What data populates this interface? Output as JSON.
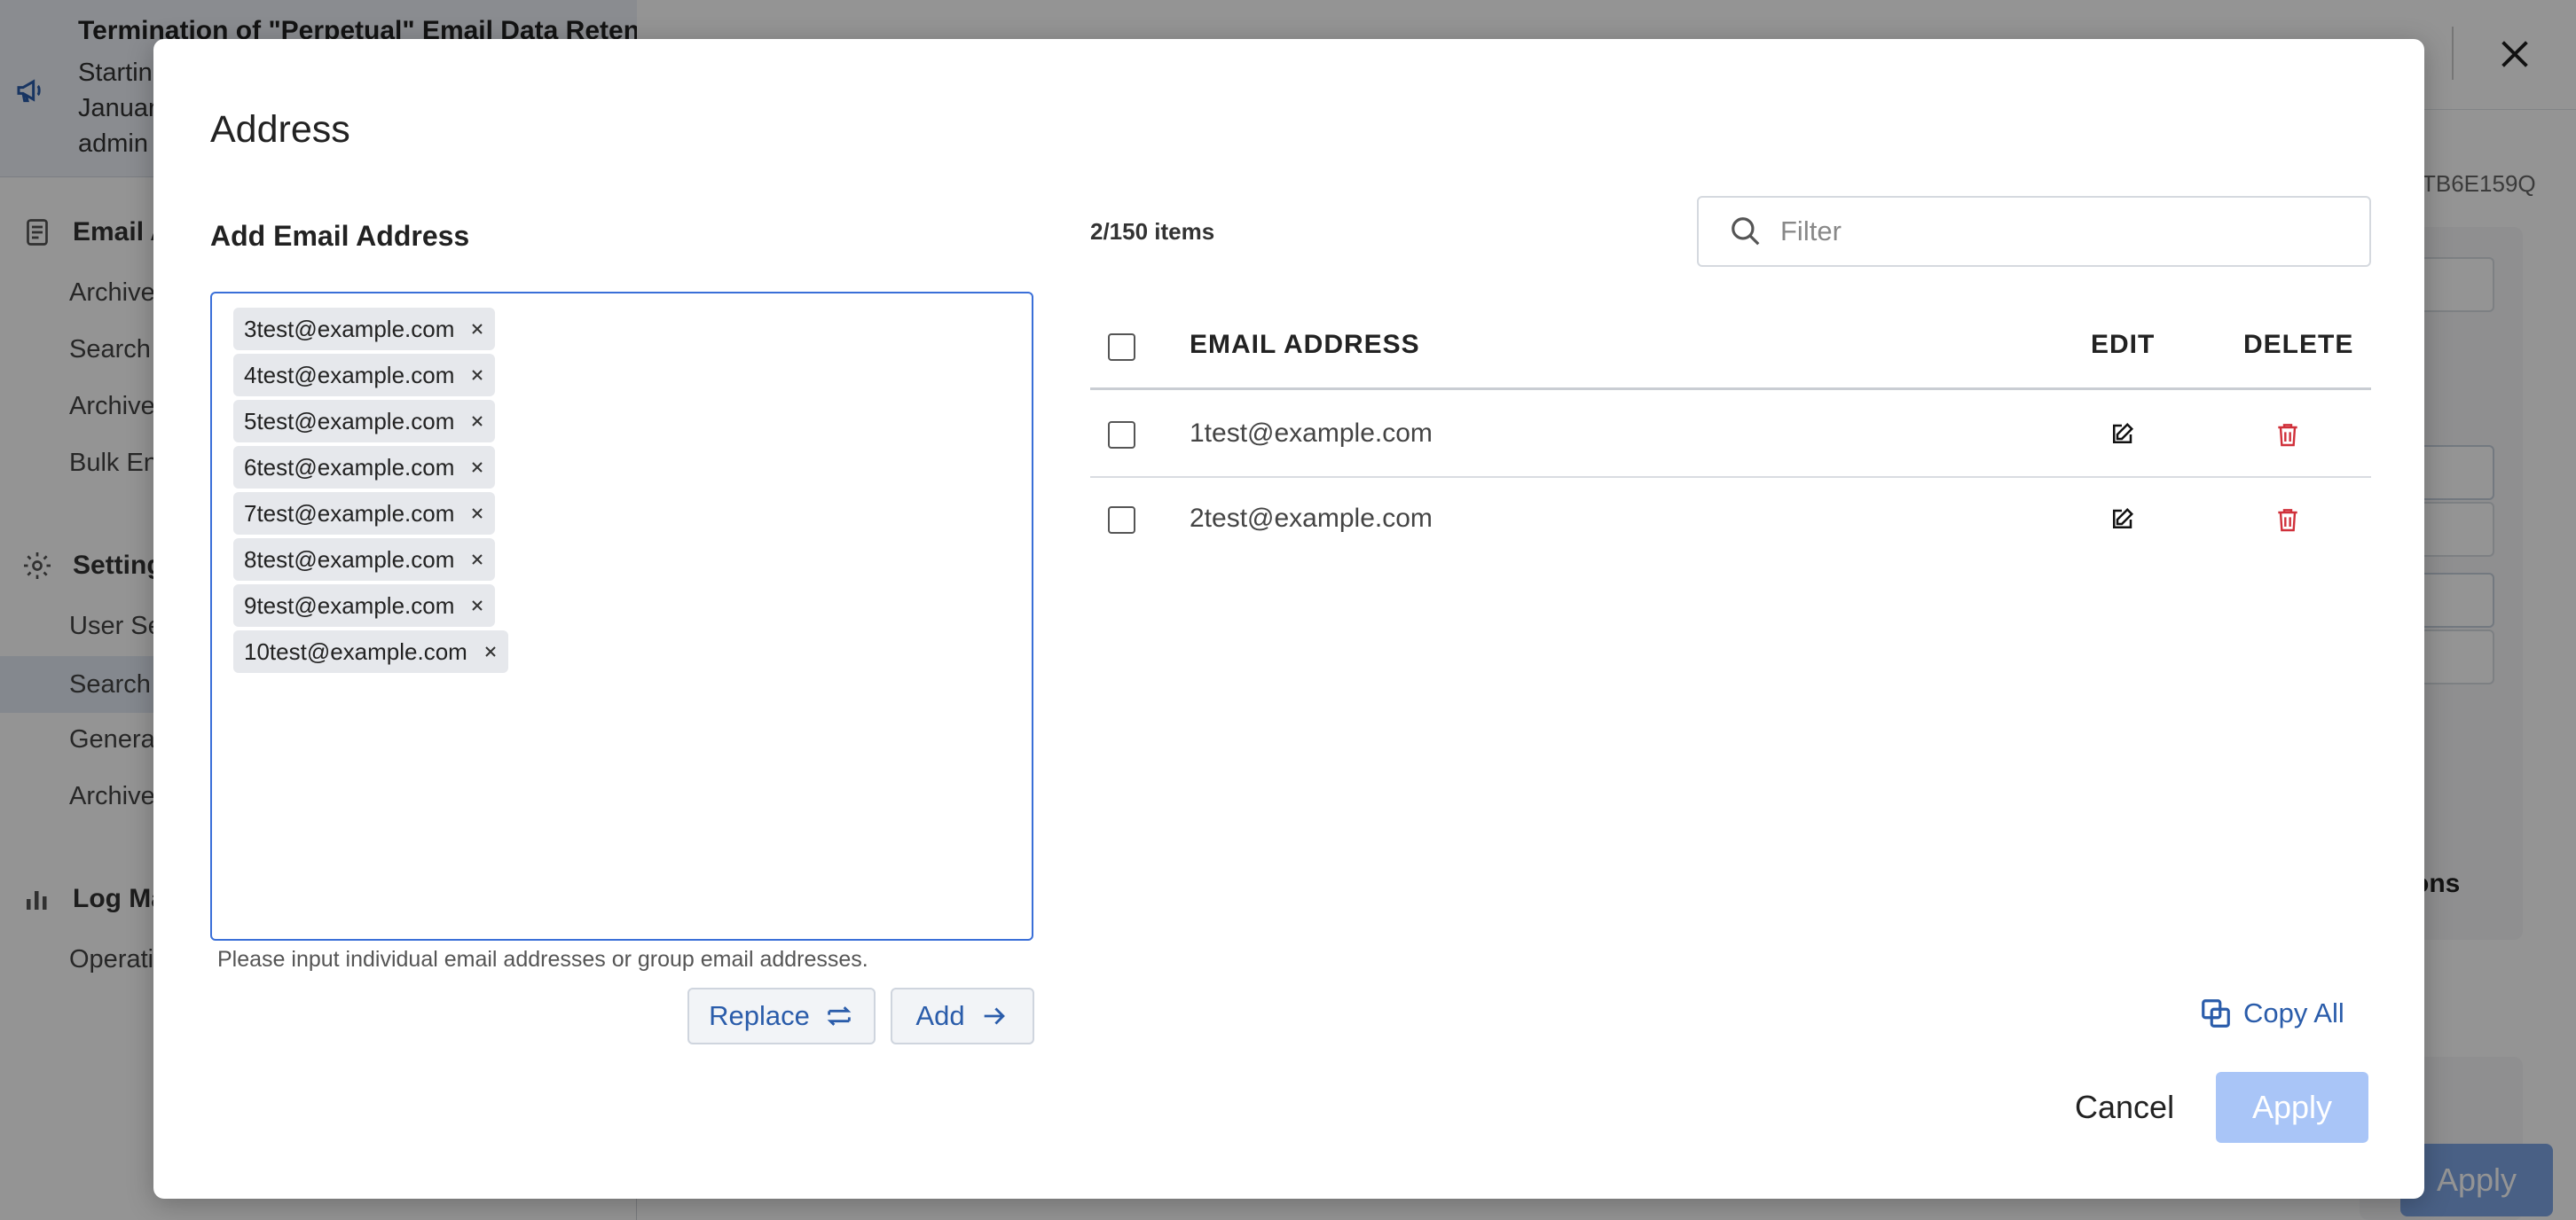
{
  "background": {
    "announcement": {
      "title": "Termination of \"Perpetual\" Email Data Retent",
      "line1": "Startin",
      "line2": "Januar",
      "line3": "admin"
    },
    "sidebar": {
      "sections": [
        {
          "label": "Email A",
          "items": [
            "Archive",
            "Search",
            "Archive",
            "Bulk En"
          ]
        },
        {
          "label": "Setting",
          "items": [
            "User Se",
            "Search",
            "Genera",
            "Archive"
          ]
        },
        {
          "label": "Log Ma",
          "items": [
            "Operati"
          ]
        }
      ]
    },
    "id_text": "TB6E159Q",
    "side_text": "ons",
    "apply_label": "Apply"
  },
  "modal": {
    "title": "Address",
    "add_label": "Add Email Address",
    "chips": [
      "3test@example.com",
      "4test@example.com",
      "5test@example.com",
      "6test@example.com",
      "7test@example.com",
      "8test@example.com",
      "9test@example.com",
      "10test@example.com"
    ],
    "helper": "Please input individual email addresses or group email addresses.",
    "replace_label": "Replace",
    "add_button_label": "Add",
    "items_count": "2/150 items",
    "filter_placeholder": "Filter",
    "columns": {
      "email": "EMAIL ADDRESS",
      "edit": "EDIT",
      "delete": "DELETE"
    },
    "rows": [
      {
        "email": "1test@example.com"
      },
      {
        "email": "2test@example.com"
      }
    ],
    "copy_all_label": "Copy All",
    "cancel_label": "Cancel",
    "apply_label": "Apply"
  },
  "colors": {
    "accent": "#2a5caa",
    "focus_border": "#3a6fd8",
    "apply_disabled": "#a9c5f7",
    "delete_icon": "#d0303a",
    "overlay": "rgba(0,0,0,0.42)"
  }
}
